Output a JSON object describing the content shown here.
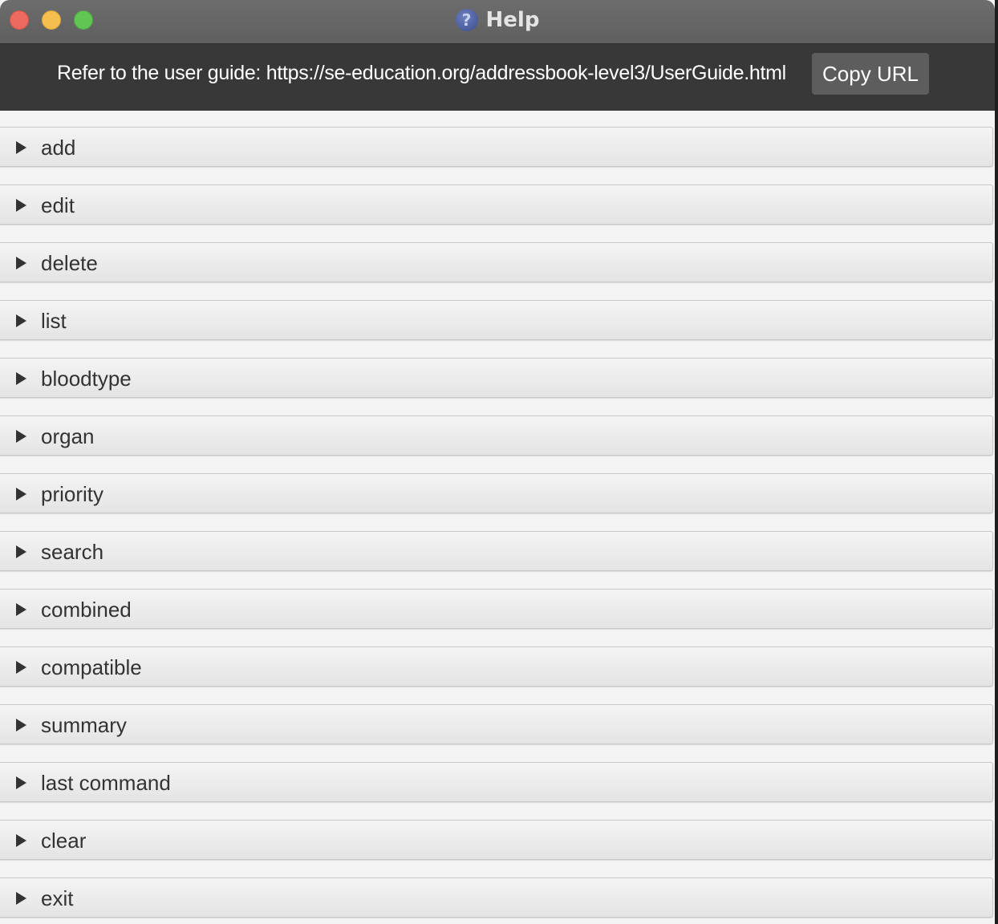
{
  "window": {
    "title": "Help",
    "title_icon": "help-question-icon"
  },
  "header": {
    "text": "Refer to the user guide: https://se-education.org/addressbook-level3/UserGuide.html",
    "copy_button_label": "Copy URL"
  },
  "colors": {
    "titlebar": "#666666",
    "header_bg": "#383838",
    "button_bg": "#5d5d5d",
    "list_bg": "#f4f4f4",
    "close": "#ed6a5e",
    "minimize": "#f5bf4f",
    "maximize": "#61c554"
  },
  "sections": [
    {
      "label": "add",
      "expanded": false
    },
    {
      "label": "edit",
      "expanded": false
    },
    {
      "label": "delete",
      "expanded": false
    },
    {
      "label": "list",
      "expanded": false
    },
    {
      "label": "bloodtype",
      "expanded": false
    },
    {
      "label": "organ",
      "expanded": false
    },
    {
      "label": "priority",
      "expanded": false
    },
    {
      "label": "search",
      "expanded": false
    },
    {
      "label": "combined",
      "expanded": false
    },
    {
      "label": "compatible",
      "expanded": false
    },
    {
      "label": "summary",
      "expanded": false
    },
    {
      "label": "last command",
      "expanded": false
    },
    {
      "label": "clear",
      "expanded": false
    },
    {
      "label": "exit",
      "expanded": false
    }
  ]
}
